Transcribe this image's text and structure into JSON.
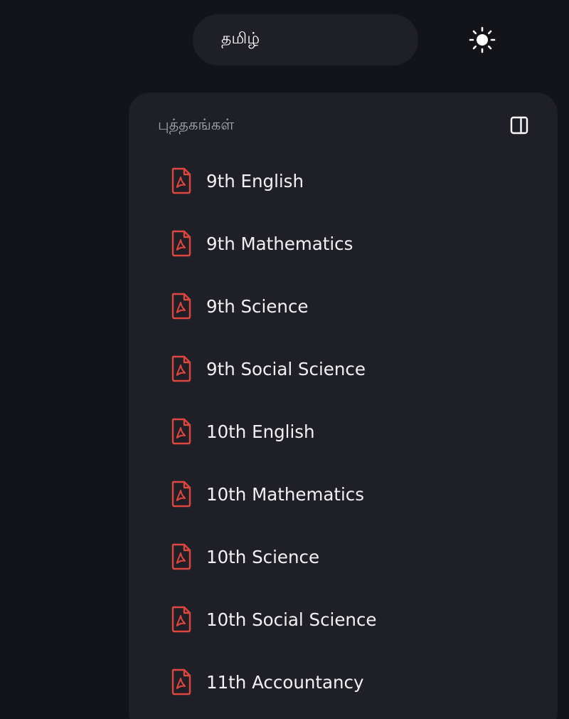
{
  "header": {
    "language_label": "தமிழ்",
    "theme_icon": "sun-icon"
  },
  "panel": {
    "title": "புத்தகங்கள்",
    "collapse_icon": "sidebar-panel-icon",
    "books": [
      {
        "label": "9th English",
        "icon": "pdf-file-icon"
      },
      {
        "label": "9th Mathematics",
        "icon": "pdf-file-icon"
      },
      {
        "label": "9th Science",
        "icon": "pdf-file-icon"
      },
      {
        "label": "9th Social Science",
        "icon": "pdf-file-icon"
      },
      {
        "label": "10th English",
        "icon": "pdf-file-icon"
      },
      {
        "label": "10th Mathematics",
        "icon": "pdf-file-icon"
      },
      {
        "label": "10th Science",
        "icon": "pdf-file-icon"
      },
      {
        "label": "10th Social Science",
        "icon": "pdf-file-icon"
      },
      {
        "label": "11th Accountancy",
        "icon": "pdf-file-icon"
      }
    ]
  },
  "colors": {
    "background": "#13141a",
    "panel": "#1f2027",
    "pdf_accent": "#e0463e",
    "muted_text": "#a3a4ab"
  }
}
